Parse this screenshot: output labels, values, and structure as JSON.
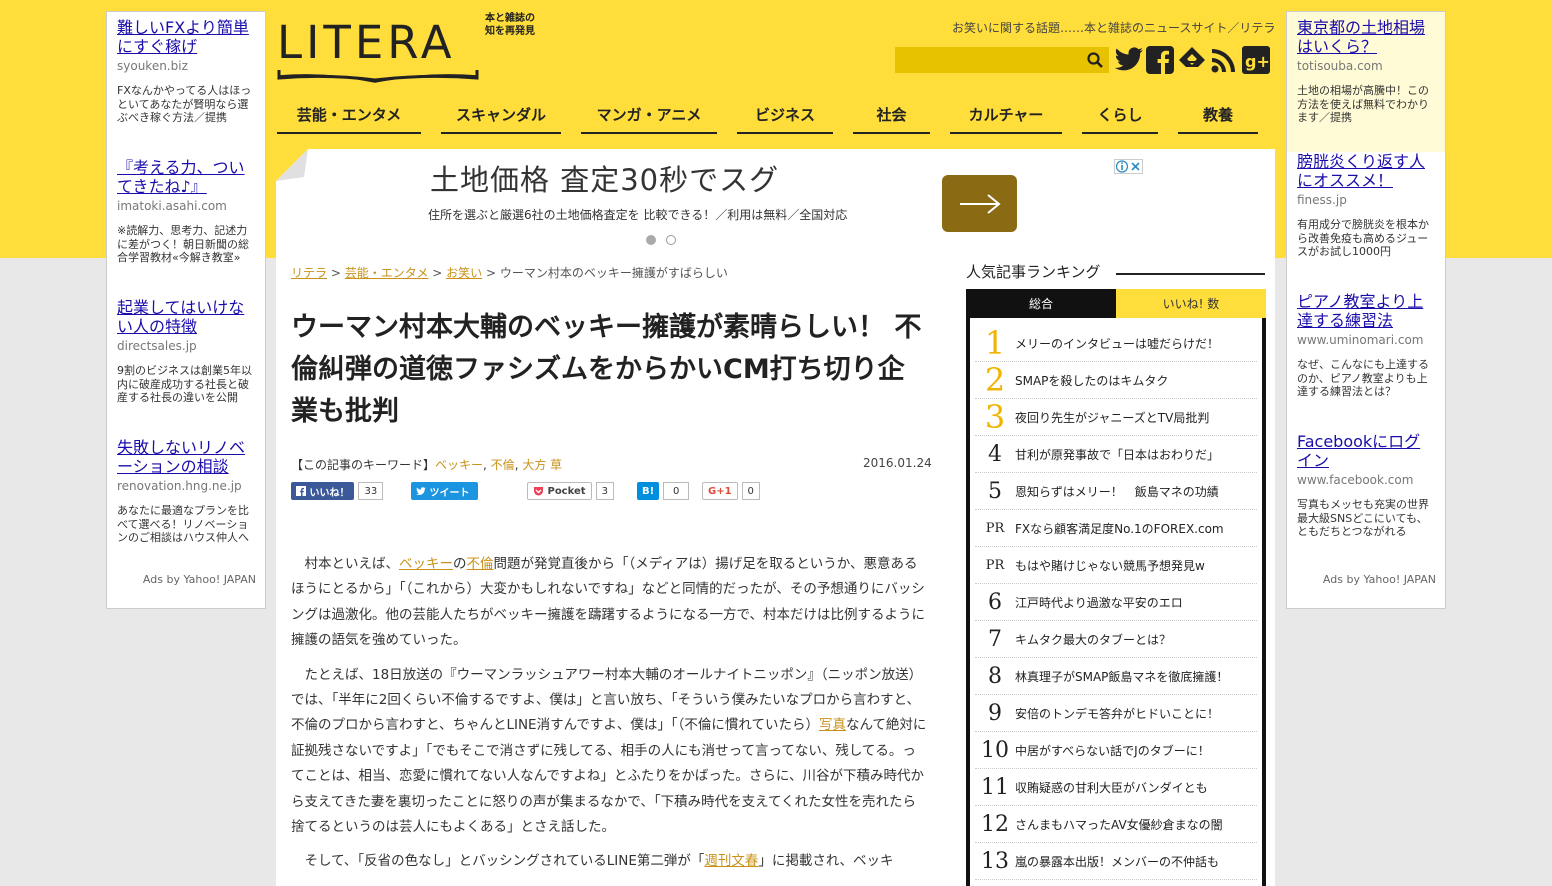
{
  "left_ads": [
    {
      "title": "難しいFXより簡単にすぐ稼げ",
      "domain": "syouken.biz",
      "desc": "FXなんかやってる人はほっといてあなたが賢明なら選ぶべき稼ぐ方法／提携"
    },
    {
      "title": "『考える力、ついてきたね♪』",
      "domain": "imatoki.asahi.com",
      "desc": "※読解力、思考力、記述力に差がつく！朝日新聞の総合学習教材«今解き教室»"
    },
    {
      "title": "起業してはいけない人の特徴",
      "domain": "directsales.jp",
      "desc": "9割のビジネスは創業5年以内に破産成功する社長と破産する社長の違いを公開"
    },
    {
      "title": "失敗しないリノベーションの相談",
      "domain": "renovation.hng.ne.jp",
      "desc": "あなたに最適なプランを比べて選べる！リノベーションのご相談はハウス仲人へ"
    }
  ],
  "right_ads": [
    {
      "title": "東京都の土地相場はいくら？",
      "domain": "totisouba.com",
      "desc": "土地の相場が高騰中！この方法を使えば無料でわかります／提携"
    },
    {
      "title": "膀胱炎くり返す人にオススメ！",
      "domain": "finess.jp",
      "desc": "有用成分で膀胱炎を根本から改善免疫も高めるジュースがお試し1000円"
    },
    {
      "title": "ピアノ教室より上達する練習法",
      "domain": "www.uminomari.com",
      "desc": "なぜ、こんなにも上達するのか、ピアノ教室よりも上達する練習法とは？"
    },
    {
      "title": "Facebookにログイン",
      "domain": "www.facebook.com",
      "desc": "写真もメッセも充実の世界最大級SNSどこにいても、ともだちとつながれる"
    }
  ],
  "ads_by": "Ads by Yahoo! JAPAN",
  "header": {
    "logo": "LITERA",
    "logo_tag_1": "本と雑誌の",
    "logo_tag_2": "知を再発見",
    "tagline": "お笑いに関する話題……本と雑誌のニュースサイト／リテラ",
    "search_placeholder": ""
  },
  "nav": [
    "芸能・エンタメ",
    "スキャンダル",
    "マンガ・アニメ",
    "ビジネス",
    "社会",
    "カルチャー",
    "くらし",
    "教養"
  ],
  "banner": {
    "headline": "土地価格 査定30秒でスグ",
    "sub": "住所を選ぶと厳選6社の土地価格査定を 比較できる！／利用は無料／全国対応"
  },
  "breadcrumb": {
    "home": "リテラ",
    "cat": "芸能・エンタメ",
    "sub": "お笑い",
    "current": "ウーマン村本のベッキー擁護がすばらしい",
    "sep": ">"
  },
  "article": {
    "title": "ウーマン村本大輔のベッキー擁護が素晴らしい！ 不倫糾弾の道徳ファシズムをからかいCM打ち切り企業も批判",
    "keywords_label": "【この記事のキーワード】",
    "keywords": [
      "ベッキー",
      "不倫",
      "大方 草"
    ],
    "date": "2016.01.24",
    "p1_a": "村本といえば、",
    "p1_link1": "ベッキー",
    "p1_b": "の",
    "p1_link2": "不倫",
    "p1_c": "問題が発覚直後から「（メディアは）揚げ足を取るというか、悪意あるほうにとるから」「（これから）大変かもしれないですね」などと同情的だったが、その予想通りにバッシングは過激化。他の芸能人たちがベッキー擁護を躊躇するようになる一方で、村本だけは比例するように擁護の語気を強めていった。",
    "p2_a": "たとえば、18日放送の『ウーマンラッシュアワー村本大輔のオールナイトニッポン』（ニッポン放送）では、「半年に2回くらい不倫するですよ、僕は」と言い放ち、「そういう僕みたいなプロから言わすと、不倫のプロから言わすと、ちゃんとLINE消すんですよ、僕は」「（不倫に慣れていたら）",
    "p2_link": "写真",
    "p2_b": "なんて絶対に証拠残さないですよ」「でもそこで消さずに残してる、相手の人にも消せって言ってない、残してる。ってことは、相当、恋愛に慣れてない人なんですよね」とふたりをかばった。さらに、川谷が下積み時代から支えてきた妻を裏切ったことに怒りの声が集まるなかで、「下積み時代を支えてくれた女性を売れたら捨てるというのは芸人にもよくある」とさえ話した。",
    "p3_a": "そして、「反省の色なし」とバッシングされているLINE第二弾が「",
    "p3_link": "週刊文春",
    "p3_b": "」に掲載され、ベッキ"
  },
  "share": {
    "fb_label": "いいね！",
    "fb_count": "33",
    "tw_label": "ツイート",
    "pocket_label": "Pocket",
    "pocket_count": "3",
    "hatena_label": "B!",
    "hatena_count": "0",
    "gplus_label": "G+1",
    "gplus_count": "0"
  },
  "ranking": {
    "title": "人気記事ランキング",
    "tab_all": "総合",
    "tab_like": "いいね! 数",
    "items": [
      {
        "rank": "1",
        "text": "メリーのインタビューは嘘だらけだ！"
      },
      {
        "rank": "2",
        "text": "SMAPを殺したのはキムタク"
      },
      {
        "rank": "3",
        "text": "夜回り先生がジャニーズとTV局批判"
      },
      {
        "rank": "4",
        "text": "甘利が原発事故で「日本はおわりだ」"
      },
      {
        "rank": "5",
        "text": "恩知らずはメリー！　飯島マネの功績"
      },
      {
        "rank": "PR",
        "text": "FXなら顧客満足度No.1のFOREX.com"
      },
      {
        "rank": "PR",
        "text": "もはや賭けじゃない競馬予想発見w"
      },
      {
        "rank": "6",
        "text": "江戸時代より過激な平安のエロ"
      },
      {
        "rank": "7",
        "text": "キムタク最大のタブーとは？"
      },
      {
        "rank": "8",
        "text": "林真理子がSMAP飯島マネを徹底擁護！"
      },
      {
        "rank": "9",
        "text": "安倍のトンデモ答弁がヒドいことに！"
      },
      {
        "rank": "10",
        "text": "中居がすべらない話でJのタブーに！"
      },
      {
        "rank": "11",
        "text": "収賄疑惑の甘利大臣がバンダイとも"
      },
      {
        "rank": "12",
        "text": "さんまもハマったAV女優紗倉まなの闇"
      },
      {
        "rank": "13",
        "text": "嵐の暴露本出版！メンバーの不仲話も"
      }
    ]
  },
  "colors": {
    "brand_yellow": "#ffdd3a",
    "link_gold": "#c8921a",
    "ad_blue": "#1a0dab"
  }
}
